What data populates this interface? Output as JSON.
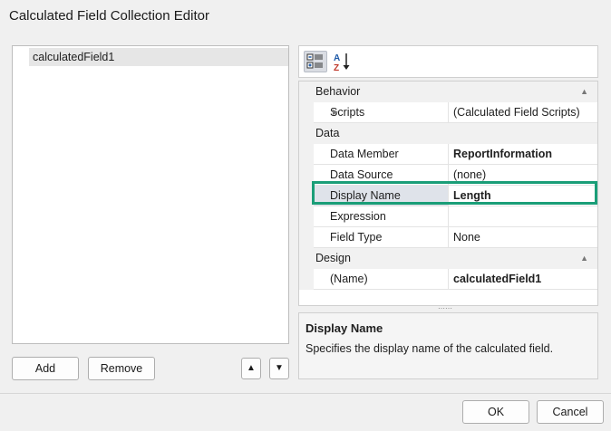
{
  "window": {
    "title": "Calculated Field Collection Editor"
  },
  "list": {
    "items": [
      "calculatedField1"
    ]
  },
  "list_buttons": {
    "add": "Add",
    "remove": "Remove",
    "up": "▲",
    "down": "▼"
  },
  "toolbar": {
    "categorized_icon": "categorized-icon",
    "alphabetical_icon": "sort-az-icon"
  },
  "property_grid": {
    "categories": [
      {
        "label": "Behavior",
        "properties": [
          {
            "name": "Scripts",
            "value": "(Calculated Field Scripts)"
          }
        ]
      },
      {
        "label": "Data",
        "properties": [
          {
            "name": "Data Member",
            "value": "ReportInformation"
          },
          {
            "name": "Data Source",
            "value": "(none)"
          },
          {
            "name": "Display Name",
            "value": "Length"
          },
          {
            "name": "Expression",
            "value": ""
          },
          {
            "name": "Field Type",
            "value": "None"
          }
        ]
      },
      {
        "label": "Design",
        "properties": [
          {
            "name": "(Name)",
            "value": "calculatedField1"
          }
        ]
      }
    ]
  },
  "description": {
    "title": "Display Name",
    "text": "Specifies the display name of the calculated field."
  },
  "dialog_buttons": {
    "ok": "OK",
    "cancel": "Cancel"
  },
  "colors": {
    "highlight": "#1a9e78",
    "selection": "#dfe3ea"
  }
}
